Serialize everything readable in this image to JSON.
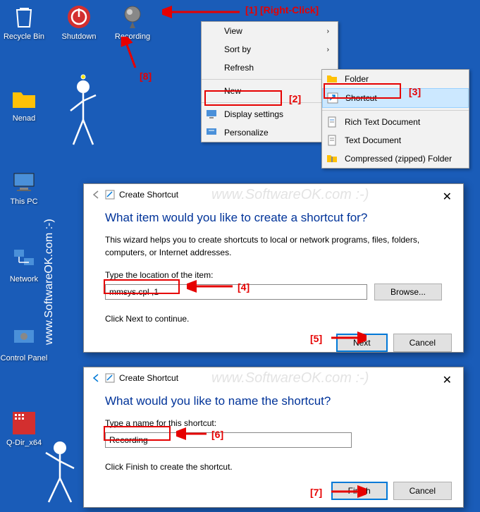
{
  "desktop_icons": {
    "recycle_bin": "Recycle Bin",
    "shutdown": "Shutdown",
    "recording": "Recording",
    "nenad": "Nenad",
    "this_pc": "This PC",
    "network": "Network",
    "control_panel": "Control Panel",
    "qdir": "Q-Dir_x64"
  },
  "context_menu": {
    "view": "View",
    "sort_by": "Sort by",
    "refresh": "Refresh",
    "new": "New",
    "display_settings": "Display settings",
    "personalize": "Personalize"
  },
  "submenu": {
    "folder": "Folder",
    "shortcut": "Shortcut",
    "rich_text": "Rich Text Document",
    "text_doc": "Text Document",
    "compressed": "Compressed (zipped) Folder"
  },
  "wizard1": {
    "window_title": "Create Shortcut",
    "title": "What item would you like to create a shortcut for?",
    "desc": "This wizard helps you to create shortcuts to local or network programs, files, folders, computers, or Internet addresses.",
    "label": "Type the location of the item:",
    "input_value": "mmsys.cpl ,1",
    "browse": "Browse...",
    "hint": "Click Next to continue.",
    "next": "Next",
    "cancel": "Cancel"
  },
  "wizard2": {
    "window_title": "Create Shortcut",
    "title": "What would you like to name the shortcut?",
    "label": "Type a name for this shortcut:",
    "input_value": "Recording",
    "hint": "Click Finish to create the shortcut.",
    "finish": "Finish",
    "cancel": "Cancel"
  },
  "annotations": {
    "a1": "[1] [Right-Click]",
    "a2": "[2]",
    "a3": "[3]",
    "a4": "[4]",
    "a5": "[5]",
    "a6": "[6]",
    "a7": "[7]",
    "a8": "[8]"
  },
  "watermark": "www.SoftwareOK.com :-)",
  "side_text": "www.SoftwareOK.com :-)"
}
